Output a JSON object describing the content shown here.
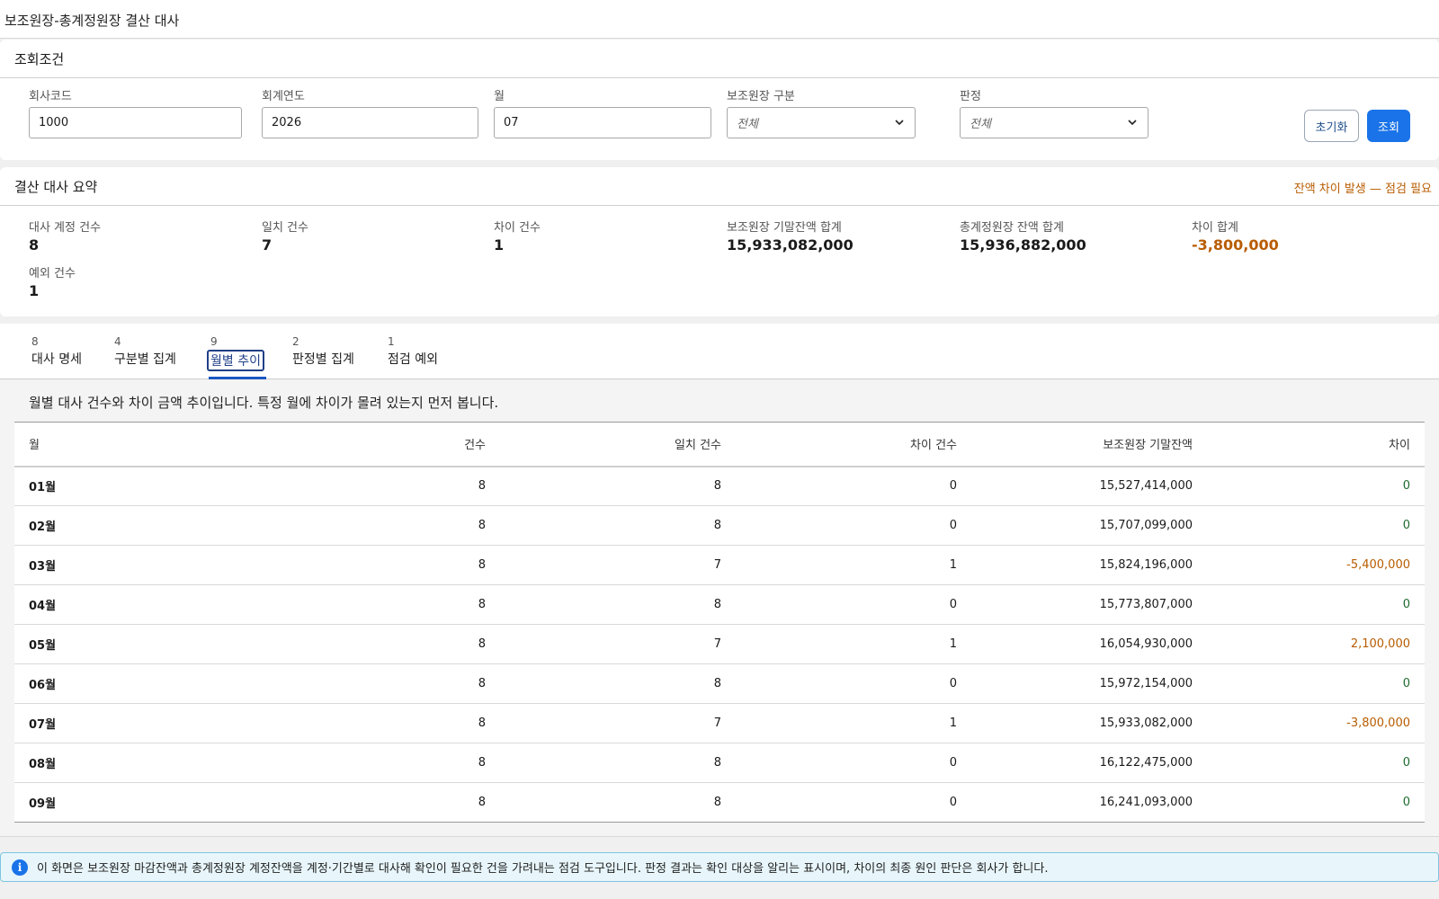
{
  "page": {
    "title": "보조원장-총계정원장 결산 대사"
  },
  "search": {
    "header": "조회조건",
    "fields": [
      {
        "label": "회사코드",
        "value": "1000"
      },
      {
        "label": "회계연도",
        "value": "2026"
      },
      {
        "label": "월",
        "value": "07"
      },
      {
        "label": "보조원장 구분",
        "value": "전체"
      },
      {
        "label": "판정",
        "value": "전체"
      }
    ],
    "reset_label": "초기화",
    "search_label": "조회"
  },
  "summary": {
    "header": "결산 대사 요약",
    "alert": "잔액 차이 발생 — 점검 필요",
    "stats": [
      {
        "label": "대사 계정 건수",
        "value": "8"
      },
      {
        "label": "일치 건수",
        "value": "7"
      },
      {
        "label": "차이 건수",
        "value": "1"
      },
      {
        "label": "보조원장 기말잔액 합계",
        "value": "15,933,082,000"
      },
      {
        "label": "총계정원장 잔액 합계",
        "value": "15,936,882,000"
      },
      {
        "label": "차이 합계",
        "value": "-3,800,000"
      },
      {
        "label": "예외 건수",
        "value": "1"
      }
    ]
  },
  "tabs": [
    {
      "count": "8",
      "label": "대사 명세"
    },
    {
      "count": "4",
      "label": "구분별 집계"
    },
    {
      "count": "9",
      "label": "월별 추이"
    },
    {
      "count": "2",
      "label": "판정별 집계"
    },
    {
      "count": "1",
      "label": "점검 예외"
    }
  ],
  "active_tab": "월별 추이",
  "monthly": {
    "intro": "월별 대사 건수와 차이 금액 추이입니다. 특정 월에 차이가 몰려 있는지 먼저 봅니다.",
    "columns": [
      "월",
      "건수",
      "일치 건수",
      "차이 건수",
      "보조원장 기말잔액",
      "차이"
    ],
    "rows": [
      {
        "month": "01월",
        "count": "8",
        "match": "8",
        "diff_count": "0",
        "balance": "15,527,414,000",
        "diff": "0"
      },
      {
        "month": "02월",
        "count": "8",
        "match": "8",
        "diff_count": "0",
        "balance": "15,707,099,000",
        "diff": "0"
      },
      {
        "month": "03월",
        "count": "8",
        "match": "7",
        "diff_count": "1",
        "balance": "15,824,196,000",
        "diff": "-5,400,000"
      },
      {
        "month": "04월",
        "count": "8",
        "match": "8",
        "diff_count": "0",
        "balance": "15,773,807,000",
        "diff": "0"
      },
      {
        "month": "05월",
        "count": "8",
        "match": "7",
        "diff_count": "1",
        "balance": "16,054,930,000",
        "diff": "2,100,000"
      },
      {
        "month": "06월",
        "count": "8",
        "match": "8",
        "diff_count": "0",
        "balance": "15,972,154,000",
        "diff": "0"
      },
      {
        "month": "07월",
        "count": "8",
        "match": "7",
        "diff_count": "1",
        "balance": "15,933,082,000",
        "diff": "-3,800,000"
      },
      {
        "month": "08월",
        "count": "8",
        "match": "8",
        "diff_count": "0",
        "balance": "16,122,475,000",
        "diff": "0"
      },
      {
        "month": "09월",
        "count": "8",
        "match": "8",
        "diff_count": "0",
        "balance": "16,241,093,000",
        "diff": "0"
      }
    ]
  },
  "info": {
    "icon": "info-icon",
    "text": "이 화면은 보조원장 마감잔액과 총계정원장 계정잔액을 계정·기간별로 대사해 확인이 필요한 건을 가려내는 점검 도구입니다. 판정 결과는 확인 대상을 알리는 표시이며, 차이의 최종 원인 판단은 회사가 합니다."
  },
  "colors": {
    "accent": "#1a73e8",
    "warning": "#b85c00",
    "ok": "#1e6b2e"
  }
}
